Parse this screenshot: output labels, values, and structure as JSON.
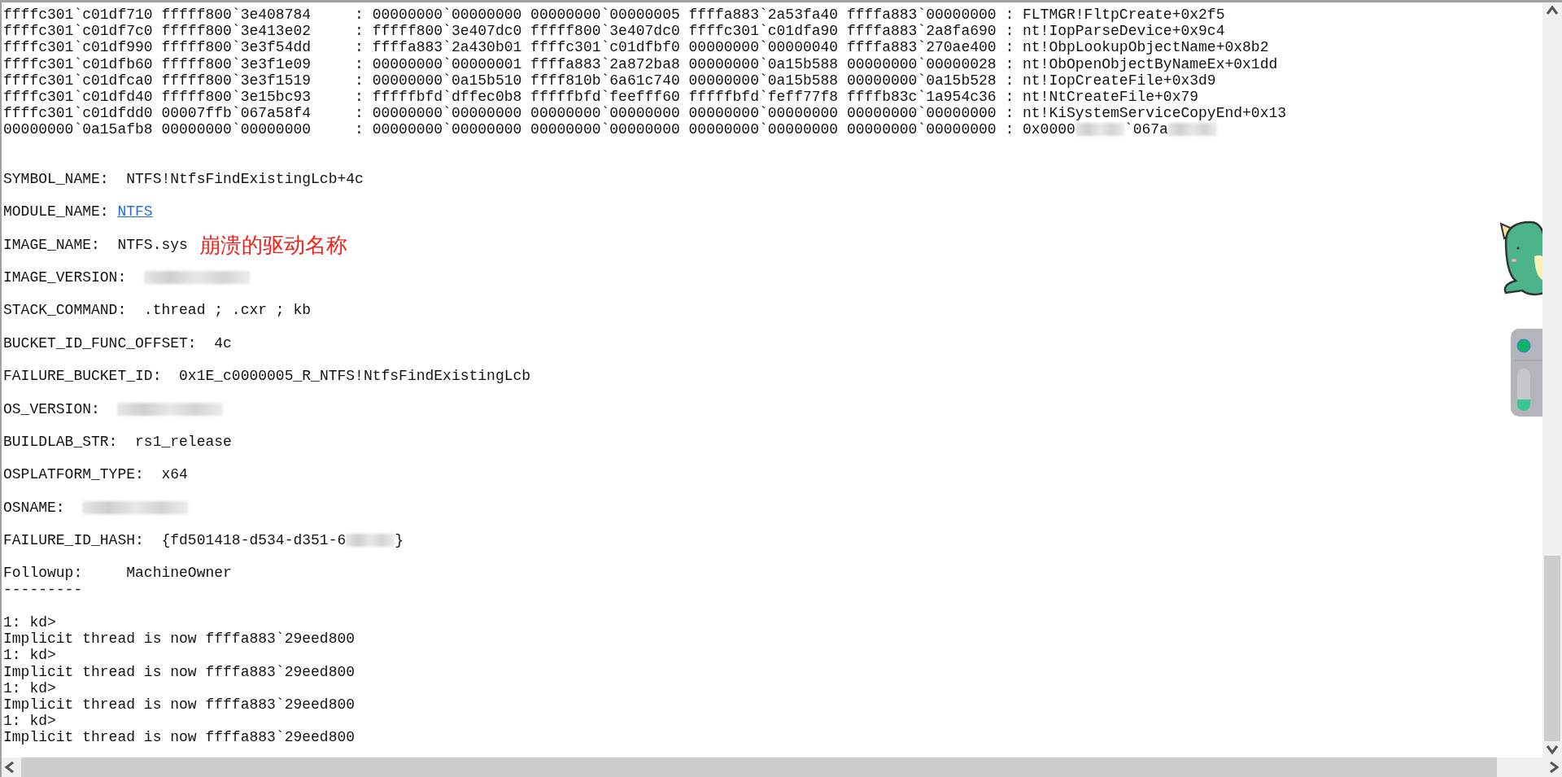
{
  "stack_frames": [
    {
      "parts": [
        {
          "kind": "text",
          "text": "ffffc301`c01df710 fffff800`3e408784     : 00000000`00000000 00000000`00000005 ffffa883`2a53fa40 ffffa883`00000000 : FLTMGR!FltpCreate+0x2f5"
        }
      ]
    },
    {
      "parts": [
        {
          "kind": "text",
          "text": "ffffc301`c01df7c0 fffff800`3e413e02     : fffff800`3e407dc0 fffff800`3e407dc0 ffffc301`c01dfa90 ffffa883`2a8fa690 : nt!IopParseDevice+0x9c4"
        }
      ]
    },
    {
      "parts": [
        {
          "kind": "text",
          "text": "ffffc301`c01df990 fffff800`3e3f54dd     : ffffa883`2a430b01 ffffc301`c01dfbf0 00000000`00000040 ffffa883`270ae400 : nt!ObpLookupObjectName+0x8b2"
        }
      ]
    },
    {
      "parts": [
        {
          "kind": "text",
          "text": "ffffc301`c01dfb60 fffff800`3e3f1e09     : 00000000`00000001 ffffa883`2a872ba8 00000000`0a15b588 00000000`00000028 : nt!ObOpenObjectByNameEx+0x1dd"
        }
      ]
    },
    {
      "parts": [
        {
          "kind": "text",
          "text": "ffffc301`c01dfca0 fffff800`3e3f1519     : 00000000`0a15b510 ffff810b`6a61c740 00000000`0a15b588 00000000`0a15b528 : nt!IopCreateFile+0x3d9"
        }
      ]
    },
    {
      "parts": [
        {
          "kind": "text",
          "text": "ffffc301`c01dfd40 fffff800`3e15bc93     : fffffbfd`dffec0b8 fffffbfd`feefff60 fffffbfd`feff77f8 ffffb83c`1a954c36 : nt!NtCreateFile+0x79"
        }
      ]
    },
    {
      "parts": [
        {
          "kind": "text",
          "text": "ffffc301`c01dfdd0 00007ffb`067a58f4     : 00000000`00000000 00000000`00000000 00000000`00000000 00000000`00000000 : nt!KiSystemServiceCopyEnd+0x13"
        }
      ]
    },
    {
      "parts": [
        {
          "kind": "text",
          "text": "00000000`0a15afb8 00000000`00000000     : 00000000`00000000 00000000`00000000 00000000`00000000 00000000`00000000 : 0x0000"
        },
        {
          "kind": "redacted"
        },
        {
          "kind": "text",
          "text": "`067a"
        },
        {
          "kind": "redacted"
        }
      ]
    }
  ],
  "fields": [
    {
      "label": "SYMBOL_NAME:  ",
      "parts": [
        {
          "kind": "text",
          "text": "NTFS!NtfsFindExistingLcb+4c"
        }
      ]
    },
    {
      "label": "MODULE_NAME: ",
      "parts": [
        {
          "kind": "link",
          "text": "NTFS"
        }
      ]
    },
    {
      "label": "IMAGE_NAME:  ",
      "parts": [
        {
          "kind": "text",
          "text": "NTFS.sys"
        }
      ],
      "annotation": "崩溃的驱动名称"
    },
    {
      "label": "IMAGE_VERSION:  ",
      "parts": [
        {
          "kind": "redacted"
        }
      ]
    },
    {
      "label": "STACK_COMMAND:  ",
      "parts": [
        {
          "kind": "text",
          "text": ".thread ; .cxr ; kb"
        }
      ]
    },
    {
      "label": "BUCKET_ID_FUNC_OFFSET:  ",
      "parts": [
        {
          "kind": "text",
          "text": "4c"
        }
      ]
    },
    {
      "label": "FAILURE_BUCKET_ID:  ",
      "parts": [
        {
          "kind": "text",
          "text": "0x1E_c0000005_R_NTFS!NtfsFindExistingLcb"
        }
      ]
    },
    {
      "label": "OS_VERSION:  ",
      "parts": [
        {
          "kind": "redacted"
        }
      ]
    },
    {
      "label": "BUILDLAB_STR:  ",
      "parts": [
        {
          "kind": "text",
          "text": "rs1_release"
        }
      ]
    },
    {
      "label": "OSPLATFORM_TYPE:  ",
      "parts": [
        {
          "kind": "text",
          "text": "x64"
        }
      ]
    },
    {
      "label": "OSNAME:  ",
      "parts": [
        {
          "kind": "redacted"
        }
      ]
    },
    {
      "label": "FAILURE_ID_HASH:  ",
      "parts": [
        {
          "kind": "text",
          "text": "{fd501418-d534-d351-6"
        },
        {
          "kind": "redacted"
        },
        {
          "kind": "text",
          "text": "}"
        }
      ]
    },
    {
      "label": "Followup:     ",
      "parts": [
        {
          "kind": "text",
          "text": "MachineOwner"
        }
      ]
    }
  ],
  "separator": "---------",
  "session": [
    "1: kd>",
    "Implicit thread is now ffffa883`29eed800",
    "1: kd>",
    "Implicit thread is now ffffa883`29eed800",
    "1: kd>",
    "Implicit thread is now ffffa883`29eed800",
    "1: kd>",
    "Implicit thread is now ffffa883`29eed800"
  ]
}
